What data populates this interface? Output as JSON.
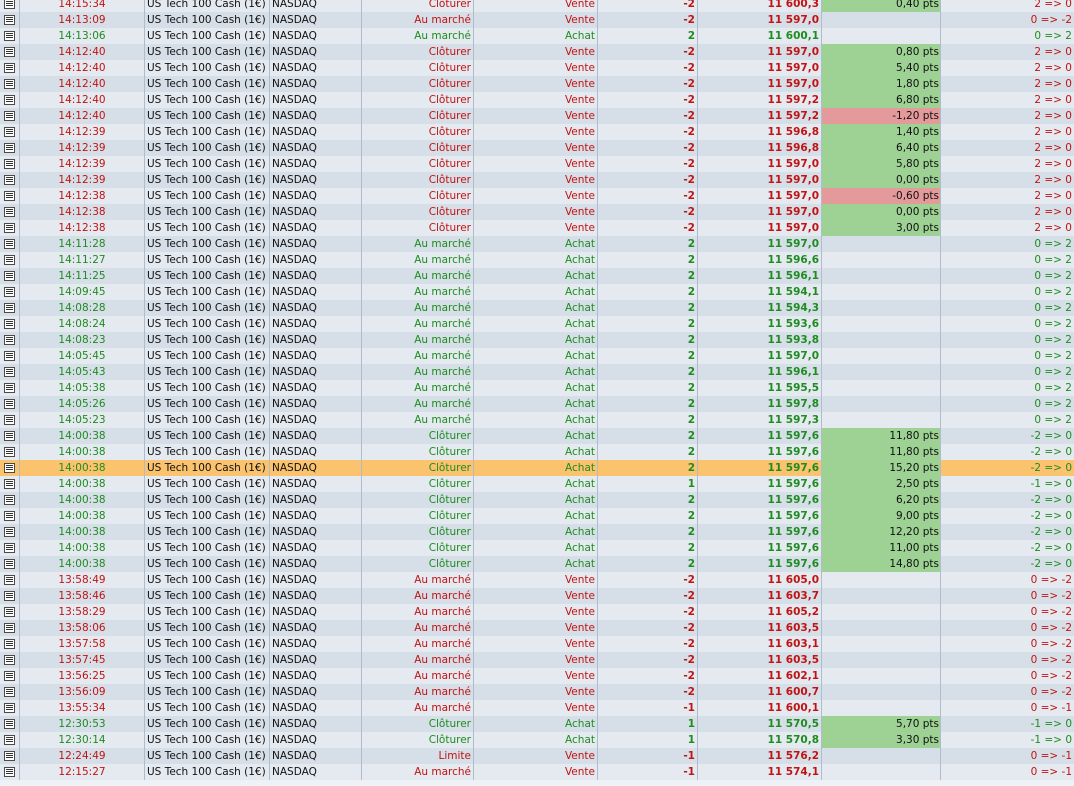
{
  "colors": {
    "buy_text": "#1e8c1e",
    "sell_text": "#c21313",
    "profit_bg": "#9ed294",
    "loss_bg": "#e49a9a",
    "selected_row_bg": "#fbc36e"
  },
  "selected_row": 29,
  "rows": [
    {
      "time": "14:15:34",
      "instrument": "US Tech 100 Cash (1€)",
      "market": "NASDAQ",
      "order": "Clôturer",
      "side": "Vente",
      "qty": "-2",
      "price": "11 600,3",
      "pnl": "0,40 pts",
      "position": "2 => 0"
    },
    {
      "time": "14:13:09",
      "instrument": "US Tech 100 Cash (1€)",
      "market": "NASDAQ",
      "order": "Au marché",
      "side": "Vente",
      "qty": "-2",
      "price": "11 597,0",
      "pnl": "",
      "position": "0 => -2"
    },
    {
      "time": "14:13:06",
      "instrument": "US Tech 100 Cash (1€)",
      "market": "NASDAQ",
      "order": "Au marché",
      "side": "Achat",
      "qty": "2",
      "price": "11 600,1",
      "pnl": "",
      "position": "0 => 2"
    },
    {
      "time": "14:12:40",
      "instrument": "US Tech 100 Cash (1€)",
      "market": "NASDAQ",
      "order": "Clôturer",
      "side": "Vente",
      "qty": "-2",
      "price": "11 597,0",
      "pnl": "0,80 pts",
      "position": "2 => 0"
    },
    {
      "time": "14:12:40",
      "instrument": "US Tech 100 Cash (1€)",
      "market": "NASDAQ",
      "order": "Clôturer",
      "side": "Vente",
      "qty": "-2",
      "price": "11 597,0",
      "pnl": "5,40 pts",
      "position": "2 => 0"
    },
    {
      "time": "14:12:40",
      "instrument": "US Tech 100 Cash (1€)",
      "market": "NASDAQ",
      "order": "Clôturer",
      "side": "Vente",
      "qty": "-2",
      "price": "11 597,0",
      "pnl": "1,80 pts",
      "position": "2 => 0"
    },
    {
      "time": "14:12:40",
      "instrument": "US Tech 100 Cash (1€)",
      "market": "NASDAQ",
      "order": "Clôturer",
      "side": "Vente",
      "qty": "-2",
      "price": "11 597,2",
      "pnl": "6,80 pts",
      "position": "2 => 0"
    },
    {
      "time": "14:12:40",
      "instrument": "US Tech 100 Cash (1€)",
      "market": "NASDAQ",
      "order": "Clôturer",
      "side": "Vente",
      "qty": "-2",
      "price": "11 597,2",
      "pnl": "-1,20 pts",
      "position": "2 => 0"
    },
    {
      "time": "14:12:39",
      "instrument": "US Tech 100 Cash (1€)",
      "market": "NASDAQ",
      "order": "Clôturer",
      "side": "Vente",
      "qty": "-2",
      "price": "11 596,8",
      "pnl": "1,40 pts",
      "position": "2 => 0"
    },
    {
      "time": "14:12:39",
      "instrument": "US Tech 100 Cash (1€)",
      "market": "NASDAQ",
      "order": "Clôturer",
      "side": "Vente",
      "qty": "-2",
      "price": "11 596,8",
      "pnl": "6,40 pts",
      "position": "2 => 0"
    },
    {
      "time": "14:12:39",
      "instrument": "US Tech 100 Cash (1€)",
      "market": "NASDAQ",
      "order": "Clôturer",
      "side": "Vente",
      "qty": "-2",
      "price": "11 597,0",
      "pnl": "5,80 pts",
      "position": "2 => 0"
    },
    {
      "time": "14:12:39",
      "instrument": "US Tech 100 Cash (1€)",
      "market": "NASDAQ",
      "order": "Clôturer",
      "side": "Vente",
      "qty": "-2",
      "price": "11 597,0",
      "pnl": "0,00 pts",
      "position": "2 => 0"
    },
    {
      "time": "14:12:38",
      "instrument": "US Tech 100 Cash (1€)",
      "market": "NASDAQ",
      "order": "Clôturer",
      "side": "Vente",
      "qty": "-2",
      "price": "11 597,0",
      "pnl": "-0,60 pts",
      "position": "2 => 0"
    },
    {
      "time": "14:12:38",
      "instrument": "US Tech 100 Cash (1€)",
      "market": "NASDAQ",
      "order": "Clôturer",
      "side": "Vente",
      "qty": "-2",
      "price": "11 597,0",
      "pnl": "0,00 pts",
      "position": "2 => 0"
    },
    {
      "time": "14:12:38",
      "instrument": "US Tech 100 Cash (1€)",
      "market": "NASDAQ",
      "order": "Clôturer",
      "side": "Vente",
      "qty": "-2",
      "price": "11 597,0",
      "pnl": "3,00 pts",
      "position": "2 => 0"
    },
    {
      "time": "14:11:28",
      "instrument": "US Tech 100 Cash (1€)",
      "market": "NASDAQ",
      "order": "Au marché",
      "side": "Achat",
      "qty": "2",
      "price": "11 597,0",
      "pnl": "",
      "position": "0 => 2"
    },
    {
      "time": "14:11:27",
      "instrument": "US Tech 100 Cash (1€)",
      "market": "NASDAQ",
      "order": "Au marché",
      "side": "Achat",
      "qty": "2",
      "price": "11 596,6",
      "pnl": "",
      "position": "0 => 2"
    },
    {
      "time": "14:11:25",
      "instrument": "US Tech 100 Cash (1€)",
      "market": "NASDAQ",
      "order": "Au marché",
      "side": "Achat",
      "qty": "2",
      "price": "11 596,1",
      "pnl": "",
      "position": "0 => 2"
    },
    {
      "time": "14:09:45",
      "instrument": "US Tech 100 Cash (1€)",
      "market": "NASDAQ",
      "order": "Au marché",
      "side": "Achat",
      "qty": "2",
      "price": "11 594,1",
      "pnl": "",
      "position": "0 => 2"
    },
    {
      "time": "14:08:28",
      "instrument": "US Tech 100 Cash (1€)",
      "market": "NASDAQ",
      "order": "Au marché",
      "side": "Achat",
      "qty": "2",
      "price": "11 594,3",
      "pnl": "",
      "position": "0 => 2"
    },
    {
      "time": "14:08:24",
      "instrument": "US Tech 100 Cash (1€)",
      "market": "NASDAQ",
      "order": "Au marché",
      "side": "Achat",
      "qty": "2",
      "price": "11 593,6",
      "pnl": "",
      "position": "0 => 2"
    },
    {
      "time": "14:08:23",
      "instrument": "US Tech 100 Cash (1€)",
      "market": "NASDAQ",
      "order": "Au marché",
      "side": "Achat",
      "qty": "2",
      "price": "11 593,8",
      "pnl": "",
      "position": "0 => 2"
    },
    {
      "time": "14:05:45",
      "instrument": "US Tech 100 Cash (1€)",
      "market": "NASDAQ",
      "order": "Au marché",
      "side": "Achat",
      "qty": "2",
      "price": "11 597,0",
      "pnl": "",
      "position": "0 => 2"
    },
    {
      "time": "14:05:43",
      "instrument": "US Tech 100 Cash (1€)",
      "market": "NASDAQ",
      "order": "Au marché",
      "side": "Achat",
      "qty": "2",
      "price": "11 596,1",
      "pnl": "",
      "position": "0 => 2"
    },
    {
      "time": "14:05:38",
      "instrument": "US Tech 100 Cash (1€)",
      "market": "NASDAQ",
      "order": "Au marché",
      "side": "Achat",
      "qty": "2",
      "price": "11 595,5",
      "pnl": "",
      "position": "0 => 2"
    },
    {
      "time": "14:05:26",
      "instrument": "US Tech 100 Cash (1€)",
      "market": "NASDAQ",
      "order": "Au marché",
      "side": "Achat",
      "qty": "2",
      "price": "11 597,8",
      "pnl": "",
      "position": "0 => 2"
    },
    {
      "time": "14:05:23",
      "instrument": "US Tech 100 Cash (1€)",
      "market": "NASDAQ",
      "order": "Au marché",
      "side": "Achat",
      "qty": "2",
      "price": "11 597,3",
      "pnl": "",
      "position": "0 => 2"
    },
    {
      "time": "14:00:38",
      "instrument": "US Tech 100 Cash (1€)",
      "market": "NASDAQ",
      "order": "Clôturer",
      "side": "Achat",
      "qty": "2",
      "price": "11 597,6",
      "pnl": "11,80 pts",
      "position": "-2 => 0"
    },
    {
      "time": "14:00:38",
      "instrument": "US Tech 100 Cash (1€)",
      "market": "NASDAQ",
      "order": "Clôturer",
      "side": "Achat",
      "qty": "2",
      "price": "11 597,6",
      "pnl": "11,80 pts",
      "position": "-2 => 0"
    },
    {
      "time": "14:00:38",
      "instrument": "US Tech 100 Cash (1€)",
      "market": "NASDAQ",
      "order": "Clôturer",
      "side": "Achat",
      "qty": "2",
      "price": "11 597,6",
      "pnl": "15,20 pts",
      "position": "-2 => 0"
    },
    {
      "time": "14:00:38",
      "instrument": "US Tech 100 Cash (1€)",
      "market": "NASDAQ",
      "order": "Clôturer",
      "side": "Achat",
      "qty": "1",
      "price": "11 597,6",
      "pnl": "2,50 pts",
      "position": "-1 => 0"
    },
    {
      "time": "14:00:38",
      "instrument": "US Tech 100 Cash (1€)",
      "market": "NASDAQ",
      "order": "Clôturer",
      "side": "Achat",
      "qty": "2",
      "price": "11 597,6",
      "pnl": "6,20 pts",
      "position": "-2 => 0"
    },
    {
      "time": "14:00:38",
      "instrument": "US Tech 100 Cash (1€)",
      "market": "NASDAQ",
      "order": "Clôturer",
      "side": "Achat",
      "qty": "2",
      "price": "11 597,6",
      "pnl": "9,00 pts",
      "position": "-2 => 0"
    },
    {
      "time": "14:00:38",
      "instrument": "US Tech 100 Cash (1€)",
      "market": "NASDAQ",
      "order": "Clôturer",
      "side": "Achat",
      "qty": "2",
      "price": "11 597,6",
      "pnl": "12,20 pts",
      "position": "-2 => 0"
    },
    {
      "time": "14:00:38",
      "instrument": "US Tech 100 Cash (1€)",
      "market": "NASDAQ",
      "order": "Clôturer",
      "side": "Achat",
      "qty": "2",
      "price": "11 597,6",
      "pnl": "11,00 pts",
      "position": "-2 => 0"
    },
    {
      "time": "14:00:38",
      "instrument": "US Tech 100 Cash (1€)",
      "market": "NASDAQ",
      "order": "Clôturer",
      "side": "Achat",
      "qty": "2",
      "price": "11 597,6",
      "pnl": "14,80 pts",
      "position": "-2 => 0"
    },
    {
      "time": "13:58:49",
      "instrument": "US Tech 100 Cash (1€)",
      "market": "NASDAQ",
      "order": "Au marché",
      "side": "Vente",
      "qty": "-2",
      "price": "11 605,0",
      "pnl": "",
      "position": "0 => -2"
    },
    {
      "time": "13:58:46",
      "instrument": "US Tech 100 Cash (1€)",
      "market": "NASDAQ",
      "order": "Au marché",
      "side": "Vente",
      "qty": "-2",
      "price": "11 603,7",
      "pnl": "",
      "position": "0 => -2"
    },
    {
      "time": "13:58:29",
      "instrument": "US Tech 100 Cash (1€)",
      "market": "NASDAQ",
      "order": "Au marché",
      "side": "Vente",
      "qty": "-2",
      "price": "11 605,2",
      "pnl": "",
      "position": "0 => -2"
    },
    {
      "time": "13:58:06",
      "instrument": "US Tech 100 Cash (1€)",
      "market": "NASDAQ",
      "order": "Au marché",
      "side": "Vente",
      "qty": "-2",
      "price": "11 603,5",
      "pnl": "",
      "position": "0 => -2"
    },
    {
      "time": "13:57:58",
      "instrument": "US Tech 100 Cash (1€)",
      "market": "NASDAQ",
      "order": "Au marché",
      "side": "Vente",
      "qty": "-2",
      "price": "11 603,1",
      "pnl": "",
      "position": "0 => -2"
    },
    {
      "time": "13:57:45",
      "instrument": "US Tech 100 Cash (1€)",
      "market": "NASDAQ",
      "order": "Au marché",
      "side": "Vente",
      "qty": "-2",
      "price": "11 603,5",
      "pnl": "",
      "position": "0 => -2"
    },
    {
      "time": "13:56:25",
      "instrument": "US Tech 100 Cash (1€)",
      "market": "NASDAQ",
      "order": "Au marché",
      "side": "Vente",
      "qty": "-2",
      "price": "11 602,1",
      "pnl": "",
      "position": "0 => -2"
    },
    {
      "time": "13:56:09",
      "instrument": "US Tech 100 Cash (1€)",
      "market": "NASDAQ",
      "order": "Au marché",
      "side": "Vente",
      "qty": "-2",
      "price": "11 600,7",
      "pnl": "",
      "position": "0 => -2"
    },
    {
      "time": "13:55:34",
      "instrument": "US Tech 100 Cash (1€)",
      "market": "NASDAQ",
      "order": "Au marché",
      "side": "Vente",
      "qty": "-1",
      "price": "11 600,1",
      "pnl": "",
      "position": "0 => -1"
    },
    {
      "time": "12:30:53",
      "instrument": "US Tech 100 Cash (1€)",
      "market": "NASDAQ",
      "order": "Clôturer",
      "side": "Achat",
      "qty": "1",
      "price": "11 570,5",
      "pnl": "5,70 pts",
      "position": "-1 => 0"
    },
    {
      "time": "12:30:14",
      "instrument": "US Tech 100 Cash (1€)",
      "market": "NASDAQ",
      "order": "Clôturer",
      "side": "Achat",
      "qty": "1",
      "price": "11 570,8",
      "pnl": "3,30 pts",
      "position": "-1 => 0"
    },
    {
      "time": "12:24:49",
      "instrument": "US Tech 100 Cash (1€)",
      "market": "NASDAQ",
      "order": "Limite",
      "side": "Vente",
      "qty": "-1",
      "price": "11 576,2",
      "pnl": "",
      "position": "0 => -1"
    },
    {
      "time": "12:15:27",
      "instrument": "US Tech 100 Cash (1€)",
      "market": "NASDAQ",
      "order": "Au marché",
      "side": "Vente",
      "qty": "-1",
      "price": "11 574,1",
      "pnl": "",
      "position": "0 => -1"
    }
  ]
}
